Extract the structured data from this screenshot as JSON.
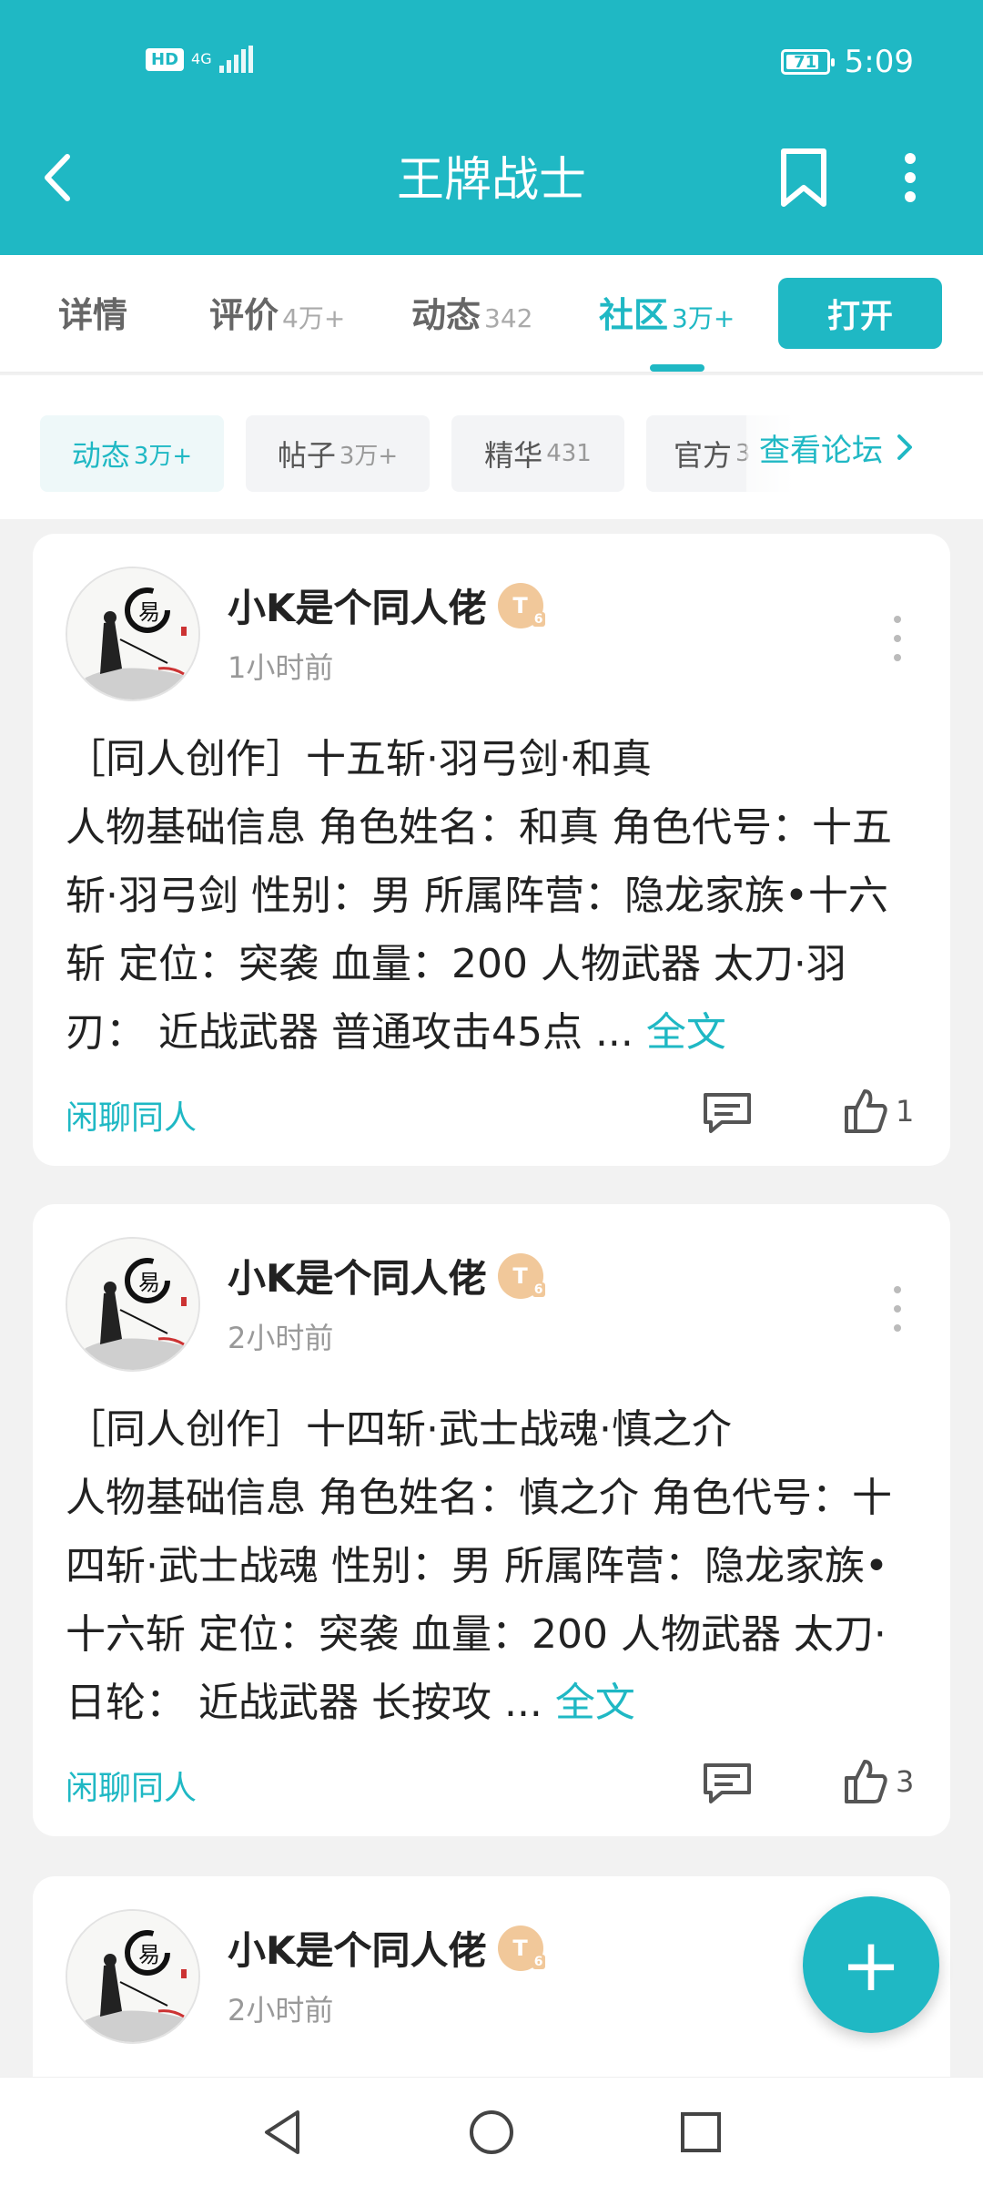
{
  "status_bar": {
    "hd": "HD",
    "network": "4G",
    "battery": "71",
    "time": "5:09"
  },
  "header": {
    "title": "王牌战士"
  },
  "tabs": [
    {
      "label": "详情",
      "count": ""
    },
    {
      "label": "评价",
      "count": "4万+"
    },
    {
      "label": "动态",
      "count": "342"
    },
    {
      "label": "社区",
      "count": "3万+",
      "active": true
    }
  ],
  "open_button": "打开",
  "chips": [
    {
      "label": "动态",
      "count": "3万+",
      "active": true
    },
    {
      "label": "帖子",
      "count": "3万+"
    },
    {
      "label": "精华",
      "count": "431"
    },
    {
      "label": "官方",
      "count": "3"
    }
  ],
  "forum_link": "查看论坛",
  "posts": [
    {
      "author": "小K是个同人佬",
      "level": "T",
      "level_sub": "6",
      "time": "1小时前",
      "title": "［同人创作］十五斩·羽弓剑·和真",
      "body": "人物基础信息 角色姓名：和真 角色代号：十五斩·羽弓剑 性别：男 所属阵营：隐龙家族•十六斩 定位：突袭 血量：200 人物武器 太刀·羽刃： 近战武器 普通攻击45点 ...",
      "more": "全文",
      "tag": "闲聊同人",
      "likes": "1"
    },
    {
      "author": "小K是个同人佬",
      "level": "T",
      "level_sub": "6",
      "time": "2小时前",
      "title": "［同人创作］十四斩·武士战魂·慎之介",
      "body": "人物基础信息 角色姓名：慎之介 角色代号：十四斩·武士战魂 性别：男 所属阵营：隐龙家族•十六斩 定位：突袭 血量：200 人物武器 太刀·日轮： 近战武器 长按攻 ...",
      "more": "全文",
      "tag": "闲聊同人",
      "likes": "3"
    },
    {
      "author": "小K是个同人佬",
      "level": "T",
      "level_sub": "6",
      "time": "2小时前"
    }
  ],
  "fab": "+"
}
